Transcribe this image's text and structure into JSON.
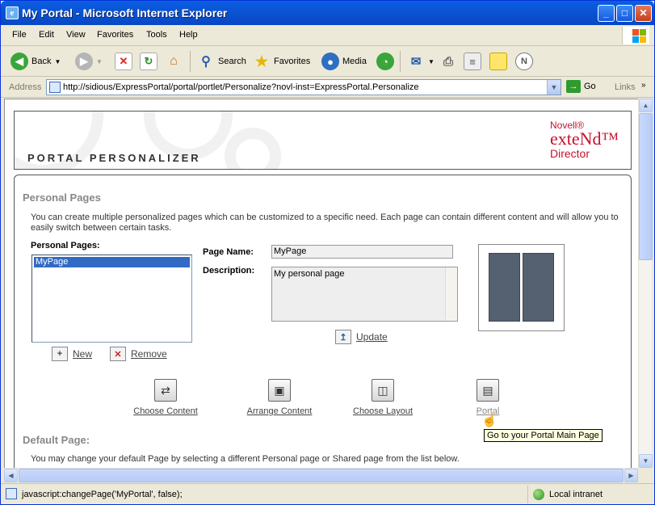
{
  "window": {
    "title": "My Portal - Microsoft Internet Explorer",
    "minimize": "_",
    "maximize": "□",
    "close": "✕"
  },
  "menu": [
    "File",
    "Edit",
    "View",
    "Favorites",
    "Tools",
    "Help"
  ],
  "toolbar": {
    "back": "Back",
    "search": "Search",
    "favorites": "Favorites",
    "media": "Media"
  },
  "address": {
    "label": "Address",
    "url": "http://sidious/ExpressPortal/portal/portlet/Personalize?novl-inst=ExpressPortal.Personalize",
    "go": "Go",
    "links": "Links"
  },
  "banner": {
    "title": "PORTAL PERSONALIZER",
    "logo_top": "Novell®",
    "logo_main": "exteNd™",
    "logo_bottom": "Director"
  },
  "personal_pages": {
    "heading": "Personal Pages",
    "description": "You can create multiple personalized pages which can be customized to a specific need. Each page can contain different content and will allow you to easily switch between certain tasks.",
    "list_label": "Personal Pages:",
    "list_items": [
      "MyPage"
    ],
    "page_name_label": "Page Name:",
    "page_name_value": "MyPage",
    "description_label": "Description:",
    "description_value": "My personal page",
    "update": "Update",
    "new": "New",
    "remove": "Remove"
  },
  "nav": {
    "choose_content": "Choose Content",
    "arrange_content": "Arrange Content",
    "choose_layout": "Choose Layout",
    "portal": "Portal"
  },
  "tooltip": "Go to your Portal Main Page",
  "default_page": {
    "heading": "Default Page:",
    "description": "You may change your default Page by selecting a different Personal page or Shared page from the list below."
  },
  "status": {
    "text": "javascript:changePage('MyPortal', false);",
    "zone": "Local intranet"
  }
}
